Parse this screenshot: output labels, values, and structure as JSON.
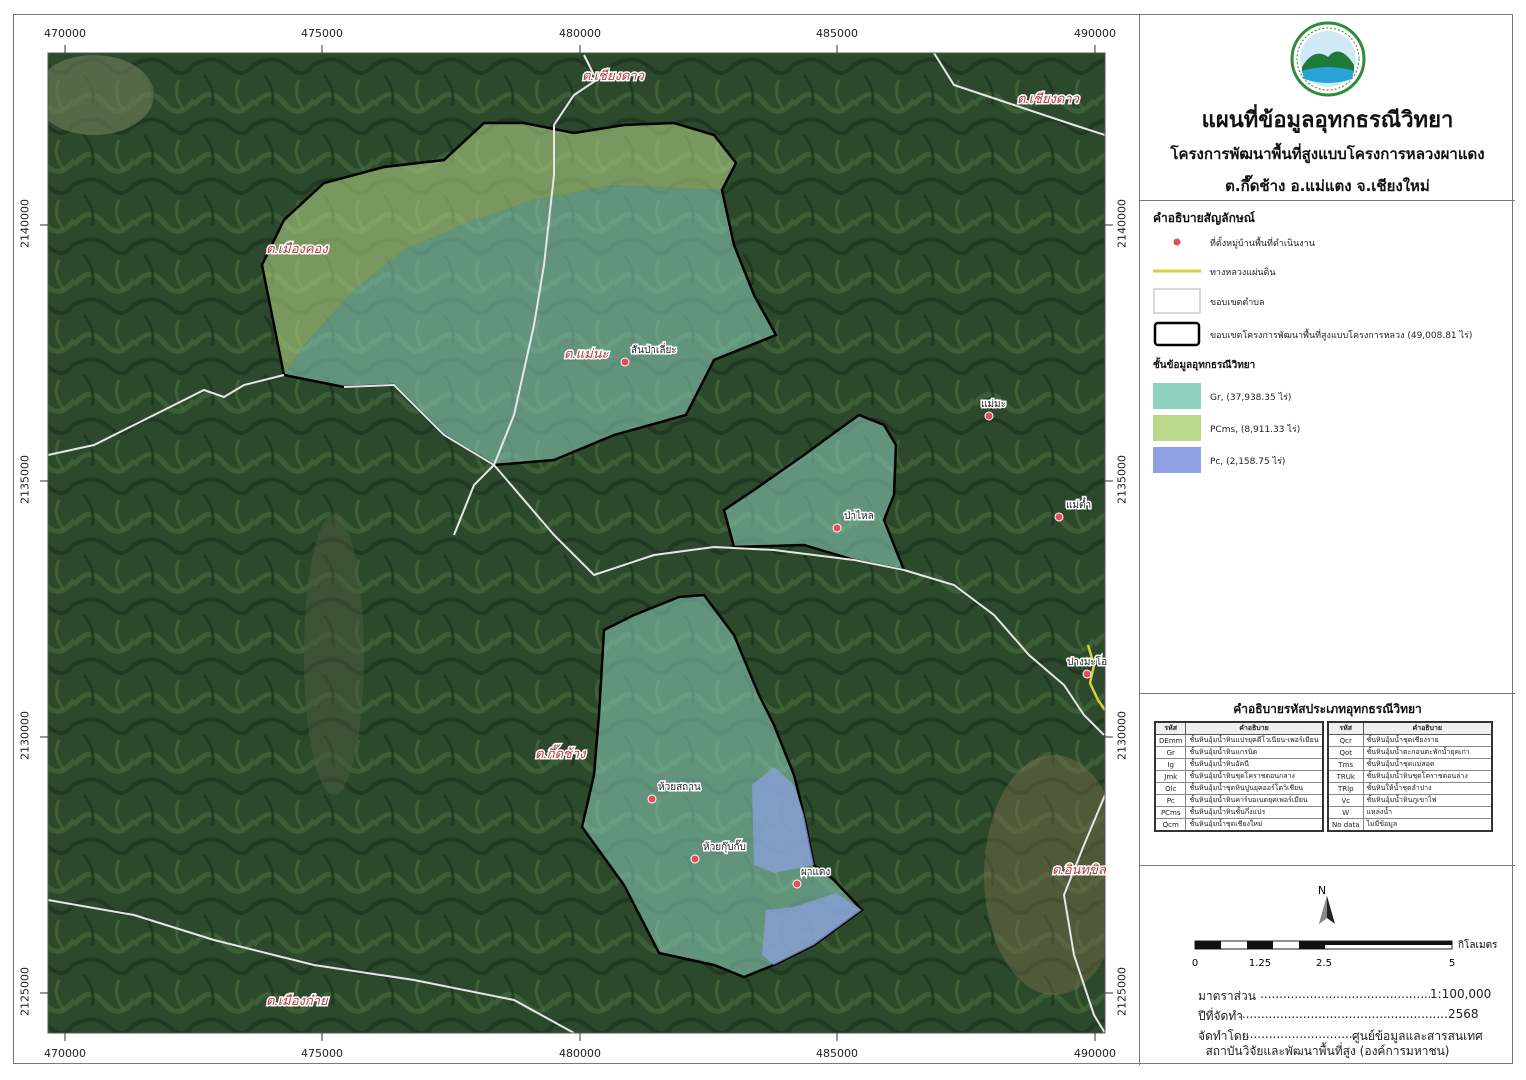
{
  "map": {
    "x_ticks": [
      "470000",
      "475000",
      "480000",
      "485000",
      "490000"
    ],
    "y_ticks": [
      "2140000",
      "2135000",
      "2130000",
      "2125000"
    ],
    "subdistrict_labels": [
      "ต.เชียงดาว",
      "ต.เชียงดาว",
      "ต.เมืองคอง",
      "ต.แม่นะ",
      "ต.กึ๊ดช้าง",
      "ต.อินทขิล",
      "ต.เมืองก๋าย"
    ],
    "village_labels": [
      "สันป่าเลี่ยะ",
      "แม่มะ",
      "ป่าไหล",
      "แม่ต๋ำ",
      "ปางมะโอ",
      "ห้วยสถาน",
      "ห้วยกุ๊บกั๊บ",
      "ผาแดง"
    ]
  },
  "title": {
    "main": "แผนที่ข้อมูลอุทกธรณีวิทยา",
    "sub1": "โครงการพัฒนาพื้นที่สูงแบบโครงการหลวงผาแดง",
    "sub2": "ต.กึ๊ดช้าง อ.แม่แตง จ.เชียงใหม่"
  },
  "legend": {
    "heading": "คำอธิบายสัญลักษณ์",
    "village": "ที่ตั้งหมู่บ้านพื้นที่ดำเนินงาน",
    "road": "ทางหลวงแผ่นดิน",
    "subdistrict": "ขอบเขตตำบล",
    "project": "ขอบเขตโครงการพัฒนาพื้นที่สูงแบบโครงการหลวง (49,008.81 ไร่)",
    "layer_heading": "ชั้นข้อมูลอุทกธรณีวิทยา",
    "layers": [
      {
        "label": "Gr, (37,938.35 ไร่)",
        "color": "#8fd1bf"
      },
      {
        "label": "PCms, (8,911.33 ไร่)",
        "color": "#b9d88a"
      },
      {
        "label": "Pc, (2,158.75 ไร่)",
        "color": "#8e9fe4"
      }
    ]
  },
  "codes": {
    "title": "คำอธิบายรหัสประเภทอุทกธรณีวิทยา",
    "col_code": "รหัส",
    "col_desc": "คำอธิบาย",
    "left": [
      [
        "DEmm",
        "ชั้นหินอุ้มน้ำหินแปรยุคดีโวเนียน-เพอร์เมียน"
      ],
      [
        "Gr",
        "ชั้นหินอุ้มน้ำหินแกรนิต"
      ],
      [
        "Ig",
        "ชั้นหินอุ้มน้ำหินอัคนี"
      ],
      [
        "Jmk",
        "ชั้นหินอุ้มน้ำหินชุดโคราชตอนกลาง"
      ],
      [
        "Olc",
        "ชั้นหินอุ้มน้ำชุดหินปูนยุคออร์โดวิเชียน"
      ],
      [
        "Pc",
        "ชั้นหินอุ้มน้ำหินคาร์บอเนตยุคเพอร์เมียน"
      ],
      [
        "PCms",
        "ชั้นหินอุ้มน้ำหินชั้นกึ่งแปร"
      ],
      [
        "Qcm",
        "ชั้นหินอุ้มน้ำชุดเชียงใหม่"
      ]
    ],
    "right": [
      [
        "Qcr",
        "ชั้นหินอุ้มน้ำชุดเชียงราย"
      ],
      [
        "Qot",
        "ชั้นหินอุ้มน้ำตะกอนตะพักน้ำยุคเก่า"
      ],
      [
        "Tms",
        "ชั้นหินอุ้มน้ำชุดแม่สอด"
      ],
      [
        "TRUk",
        "ชั้นหินอุ้มน้ำหินชุดโคราชตอนล่าง"
      ],
      [
        "TRlp",
        "ชั้นหินให้น้ำชุดลำปาง"
      ],
      [
        "Vc",
        "ชั้นหินอุ้มน้ำหินภูเขาไฟ"
      ],
      [
        "W",
        "แหล่งน้ำ"
      ],
      [
        "No data",
        "ไม่มีข้อมูล"
      ]
    ]
  },
  "scale": {
    "north": "N",
    "ticks": [
      "0",
      "1.25",
      "2.5",
      "5"
    ],
    "unit": "กิโลเมตร",
    "ratio_label": "มาตราส่วน",
    "ratio_value": "1:100,000",
    "year_label": "ปีที่จัดทำ",
    "year_value": "2568",
    "by_label": "จัดทำโดย",
    "by_value": "ศูนย์ข้อมูลและสารสนเทศ",
    "footer": "สถาบันวิจัยและพัฒนาพื้นที่สูง (องค์การมหาชน)"
  },
  "colors": {
    "gr": "#8fd1bf",
    "pcms": "#b9d88a",
    "pc": "#8e9fe4",
    "village_marker": "#e84c5c",
    "road": "#d8cf3a"
  }
}
